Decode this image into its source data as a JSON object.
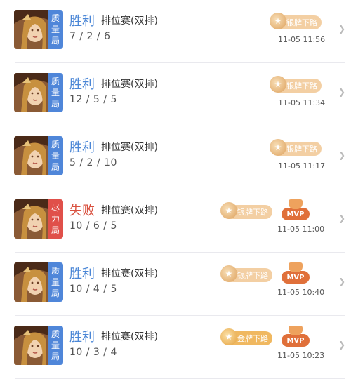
{
  "matches": [
    {
      "result": "胜利",
      "result_type": "win",
      "mode": "排位赛(双排)",
      "kda": "7 / 2 / 6",
      "tag": [
        "质",
        "量",
        "局"
      ],
      "tag_type": "quality",
      "badge": "银牌下路",
      "badge_type": "silver",
      "mvp": "",
      "time": "11-05 11:56"
    },
    {
      "result": "胜利",
      "result_type": "win",
      "mode": "排位赛(双排)",
      "kda": "12 / 5 / 5",
      "tag": [
        "质",
        "量",
        "局"
      ],
      "tag_type": "quality",
      "badge": "银牌下路",
      "badge_type": "silver",
      "mvp": "",
      "time": "11-05 11:34"
    },
    {
      "result": "胜利",
      "result_type": "win",
      "mode": "排位赛(双排)",
      "kda": "5 / 2 / 10",
      "tag": [
        "质",
        "量",
        "局"
      ],
      "tag_type": "quality",
      "badge": "银牌下路",
      "badge_type": "silver",
      "mvp": "",
      "time": "11-05 11:17"
    },
    {
      "result": "失败",
      "result_type": "lose",
      "mode": "排位赛(双排)",
      "kda": "10 / 6 / 5",
      "tag": [
        "尽",
        "力",
        "局"
      ],
      "tag_type": "effort",
      "badge": "银牌下路",
      "badge_type": "silver",
      "mvp": "MVP",
      "time": "11-05 11:00"
    },
    {
      "result": "胜利",
      "result_type": "win",
      "mode": "排位赛(双排)",
      "kda": "10 / 4 / 5",
      "tag": [
        "质",
        "量",
        "局"
      ],
      "tag_type": "quality",
      "badge": "银牌下路",
      "badge_type": "silver",
      "mvp": "MVP",
      "time": "11-05 10:40"
    },
    {
      "result": "胜利",
      "result_type": "win",
      "mode": "排位赛(双排)",
      "kda": "10 / 3 / 4",
      "tag": [
        "质",
        "量",
        "局"
      ],
      "tag_type": "quality",
      "badge": "金牌下路",
      "badge_type": "gold",
      "mvp": "MVP",
      "time": "11-05 10:23"
    }
  ],
  "icons": {
    "chevron": "chevron-right-icon",
    "avatar": "hero-portrait",
    "medal": "medal-icon",
    "trophy": "trophy-icon"
  },
  "colors": {
    "win": "#4a86d6",
    "lose": "#d9513f",
    "quality_tag": "#4f86d9",
    "effort_tag": "#e0504a",
    "mvp": "#e0703a"
  }
}
